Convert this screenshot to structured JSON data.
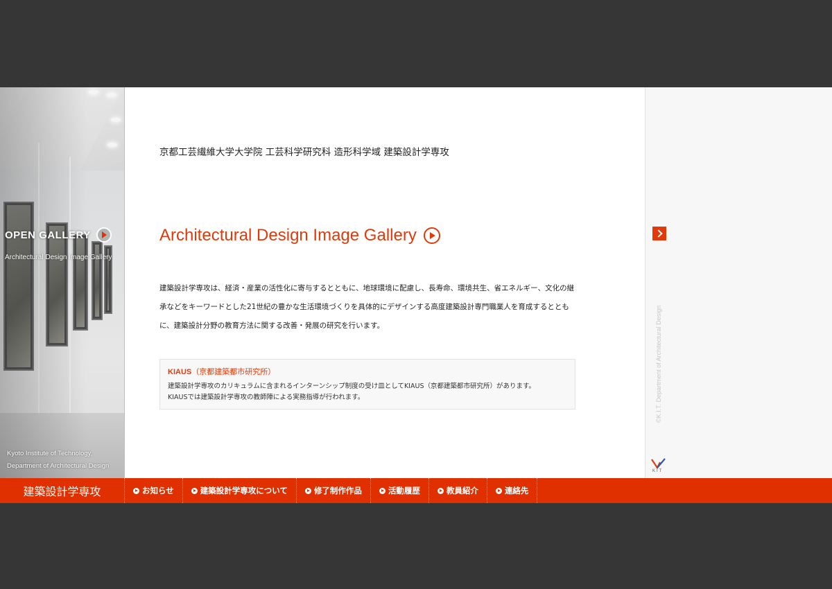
{
  "gallery_panel": {
    "open_label": "OPEN GALLERY",
    "subtitle": "Architectural Design Image Gallery",
    "caption_line1": "Kyoto Institute of Technology,",
    "caption_line2": "Department of Architectural Design"
  },
  "header": {
    "title": "京都工芸繊維大学大学院 工芸科学研究科 造形科学域 建築設計学専攻"
  },
  "main": {
    "gallery_heading": "Architectural Design Image Gallery",
    "intro_text": "建築設計学専攻は、経済・産業の活性化に寄与するとともに、地球環境に配慮し、長寿命、環境共生、省エネルギー、文化の継承などをキーワードとした21世紀の豊かな生活環境づくりを具体的にデザインする高度建築設計専門職業人を育成するとともに、建築設計分野の教育方法に関する改善・発展の研究を行います。",
    "kiaus": {
      "title": "KIAUS",
      "title_note": "（京都建築都市研究所）",
      "line1": "建築設計学専攻のカリキュラムに含まれるインターンシップ制度の受け皿としてKIAUS（京都建築都市研究所）があります。",
      "line2": "KIAUSでは建築設計学専攻の教師陣による実務指導が行われます。"
    }
  },
  "right_strip": {
    "vertical_text": "©K.I.T. Department of Architectural Design",
    "logo_label": "KIT"
  },
  "nav": {
    "brand": "建築設計学専攻",
    "items": [
      {
        "label": "お知らせ"
      },
      {
        "label": "建築設計学専攻について"
      },
      {
        "label": "修了制作作品"
      },
      {
        "label": "活動履歴"
      },
      {
        "label": "教員紹介"
      },
      {
        "label": "連絡先"
      }
    ]
  },
  "colors": {
    "accent": "#e03a0a",
    "nav_bg": "#e03000",
    "page_bg": "#363636"
  }
}
